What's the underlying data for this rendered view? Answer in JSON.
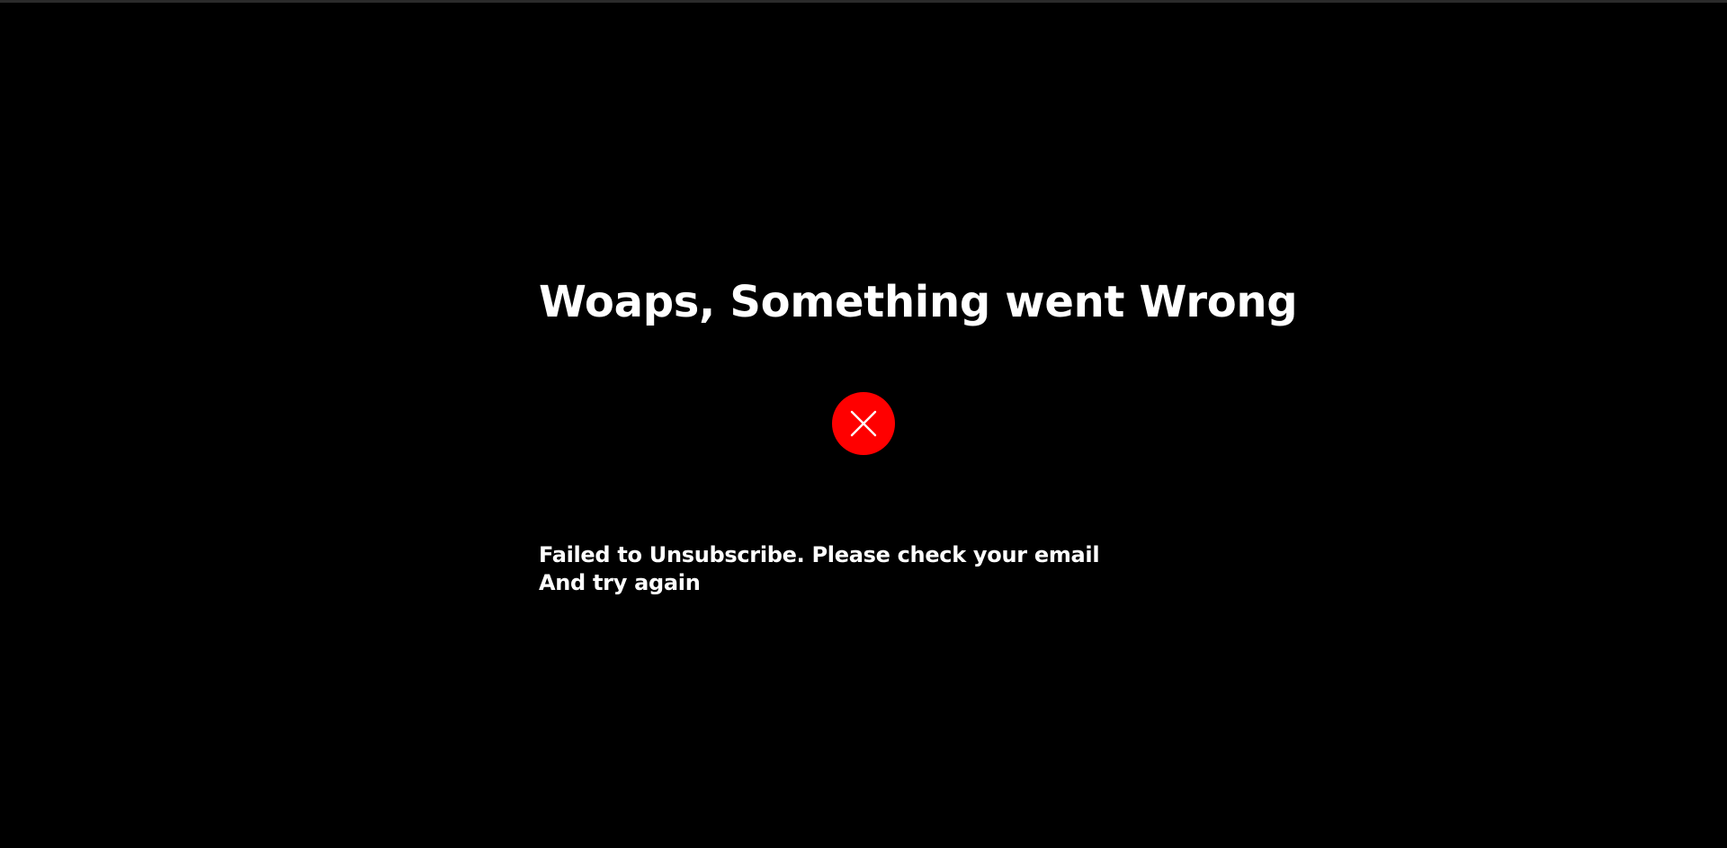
{
  "page": {
    "heading": "Woaps, Something went Wrong",
    "status_icon": "close-circle-icon",
    "message": {
      "line1": "Failed to Unsubscribe. Please check your email",
      "line2": "And try again"
    }
  },
  "colors": {
    "background": "#000000",
    "text": "#ffffff",
    "error": "#ff0000",
    "top_border": "#2b2b2b"
  }
}
